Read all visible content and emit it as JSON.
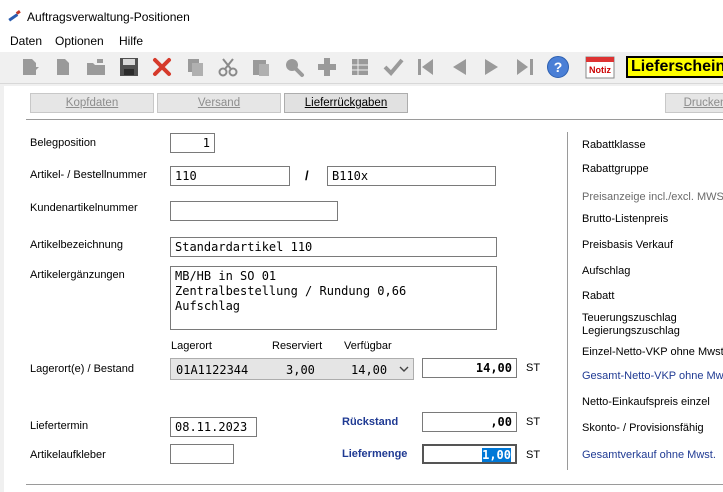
{
  "window": {
    "title": "Auftragsverwaltung-Positionen"
  },
  "menu": {
    "items": [
      "Daten",
      "Optionen",
      "Hilfe"
    ]
  },
  "toolbar": {
    "icons": [
      "new-doc-icon",
      "page-icon",
      "open-folder-icon",
      "save-icon",
      "delete-icon",
      "copy-icon",
      "cut-icon",
      "paste-icon",
      "search-icon",
      "add-icon",
      "grid-icon",
      "check-icon",
      "first-record-icon",
      "prev-record-icon",
      "next-record-icon",
      "last-record-icon",
      "help-icon",
      "notiz-icon"
    ],
    "notiz_label": "Notiz",
    "banner": "Lieferschein"
  },
  "tabs": {
    "kopfdaten": "Kopfdaten",
    "versand": "Versand",
    "lieferrueckgaben": "Lieferrückgaben",
    "drucken": "Drucken"
  },
  "form": {
    "belegposition": {
      "label": "Belegposition",
      "value": "1"
    },
    "artikel": {
      "label": "Artikel- / Bestellnummer",
      "value": "110",
      "sep": "/",
      "bestellnummer": "B110x"
    },
    "kundenartikel": {
      "label": "Kundenartikelnummer",
      "value": ""
    },
    "bezeichnung": {
      "label": "Artikelbezeichnung",
      "value": "Standardartikel 110"
    },
    "ergaenzungen": {
      "label": "Artikelergänzungen",
      "value": "MB/HB in SO 01\nZentralbestellung / Rundung 0,66\nAufschlag"
    },
    "lager": {
      "label": "Lagerort(e) / Bestand",
      "col_lagerort": "Lagerort",
      "col_reserviert": "Reserviert",
      "col_verfuegbar": "Verfügbar",
      "lagerort": "01A1122344",
      "reserviert": "3,00",
      "verfuegbar": "14,00",
      "bestand": "14,00",
      "unit": "ST"
    },
    "liefertermin": {
      "label": "Liefertermin",
      "value": "08.11.2023"
    },
    "rueckstand": {
      "label": "Rückstand",
      "value": ",00",
      "unit": "ST"
    },
    "aufkleber": {
      "label": "Artikelaufkleber",
      "value": ""
    },
    "liefermenge": {
      "label": "Liefermenge",
      "value": "1,00",
      "unit": "ST"
    }
  },
  "right_panel": {
    "rabattklasse": "Rabattklasse",
    "rabattgruppe": "Rabattgruppe",
    "preisanzeige": "Preisanzeige incl./excl. MWST",
    "brutto": "Brutto-Listenpreis",
    "preisbasis": "Preisbasis Verkauf",
    "aufschlag": "Aufschlag",
    "rabatt": "Rabatt",
    "teuerung": "Teuerungszuschlag",
    "legierung": "Legierungszuschlag",
    "einzel_netto": "Einzel-Netto-VKP ohne Mwst.",
    "gesamt_netto": "Gesamt-Netto-VKP ohne Mwst.",
    "netto_ek": "Netto-Einkaufspreis einzel",
    "skonto": "Skonto- / Provisionsfähig",
    "gesamtverkauf": "Gesamtverkauf ohne Mwst."
  }
}
